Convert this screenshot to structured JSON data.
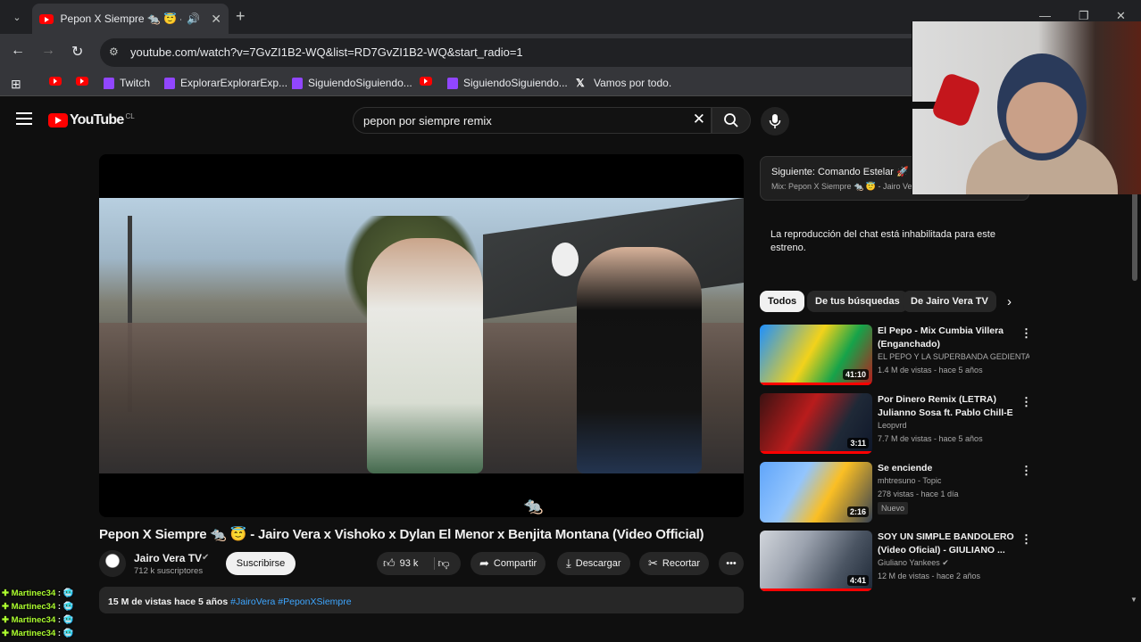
{
  "browser": {
    "tab_title": "Pepon X Siempre 🐀 😇 - Ja",
    "url": "youtube.com/watch?v=7GvZI1B2-WQ&list=RD7GvZI1B2-WQ&start_radio=1",
    "bookmarks": [
      {
        "label": "",
        "icon": "youtube-icon"
      },
      {
        "label": "",
        "icon": "youtube-icon"
      },
      {
        "label": "Twitch",
        "icon": "twitch-icon"
      },
      {
        "label": "ExplorarExplorarExp...",
        "icon": "twitch-icon"
      },
      {
        "label": "SiguiendoSiguiendo...",
        "icon": "twitch-icon"
      },
      {
        "label": "",
        "icon": "youtube-icon"
      },
      {
        "label": "SiguiendoSiguiendo...",
        "icon": "twitch-icon"
      },
      {
        "label": "Vamos por todo.",
        "icon": "x-icon"
      }
    ]
  },
  "youtube": {
    "logo_text": "YouTube",
    "country": "CL",
    "search_query": "pepon por siempre remix"
  },
  "video": {
    "title": "Pepon X Siempre 🐀 😇 - Jairo Vera x Vishoko x Dylan El Menor x Benjita Montana (Video Official)",
    "channel": "Jairo Vera TV",
    "subscribers": "712 k suscriptores",
    "subscribe_label": "Suscribirse",
    "likes": "93 k",
    "share_label": "Compartir",
    "download_label": "Descargar",
    "clip_label": "Recortar",
    "views_date": "15 M de vistas  hace 5 años",
    "tags": "#JairoVera #PeponXSiempre"
  },
  "sidebar": {
    "up_next_label": "Siguiente: Comando Estelar 🚀 - G",
    "up_next_mix": "Mix: Pepon X Siempre 🐀 😇 - Jairo Ver",
    "chat_disabled": "La reproducción del chat está inhabilitada para este estreno.",
    "chips": [
      "Todos",
      "De tus búsquedas",
      "De Jairo Vera TV"
    ],
    "recommendations": [
      {
        "title": "El Pepo - Mix Cumbia Villera (Enganchado)",
        "channel": "EL PEPO Y LA SUPERBANDA GEDIENTA ...",
        "meta": "1.4 M de vistas - hace 5 años",
        "duration": "41:10"
      },
      {
        "title": "Por Dinero Remix (LETRA) Julianno Sosa ft. Pablo Chill-E",
        "channel": "Leopvrd",
        "meta": "7.7 M de vistas - hace 5 años",
        "duration": "3:11"
      },
      {
        "title": "Se enciende",
        "channel": "mhtresuno - Topic",
        "meta": "278 vistas - hace 1 día",
        "duration": "2:16",
        "badge": "Nuevo"
      },
      {
        "title": "SOY UN SIMPLE BANDOLERO (Video Oficial) - GIULIANO ...",
        "channel": "Giuliano Yankees",
        "meta": "12 M de vistas - hace 2 años",
        "duration": "4:41"
      }
    ]
  },
  "stream_chat": [
    {
      "user": "Martinec34",
      "msg": "🥶"
    },
    {
      "user": "Martinec34",
      "msg": "🥶"
    },
    {
      "user": "Martinec34",
      "msg": "🥶"
    },
    {
      "user": "Martinec34",
      "msg": "🥶"
    }
  ],
  "colors": {
    "accent": "#ff0000",
    "background": "#0f0f0f",
    "chat_user": "#adff2f",
    "twitch": "#9146ff"
  }
}
